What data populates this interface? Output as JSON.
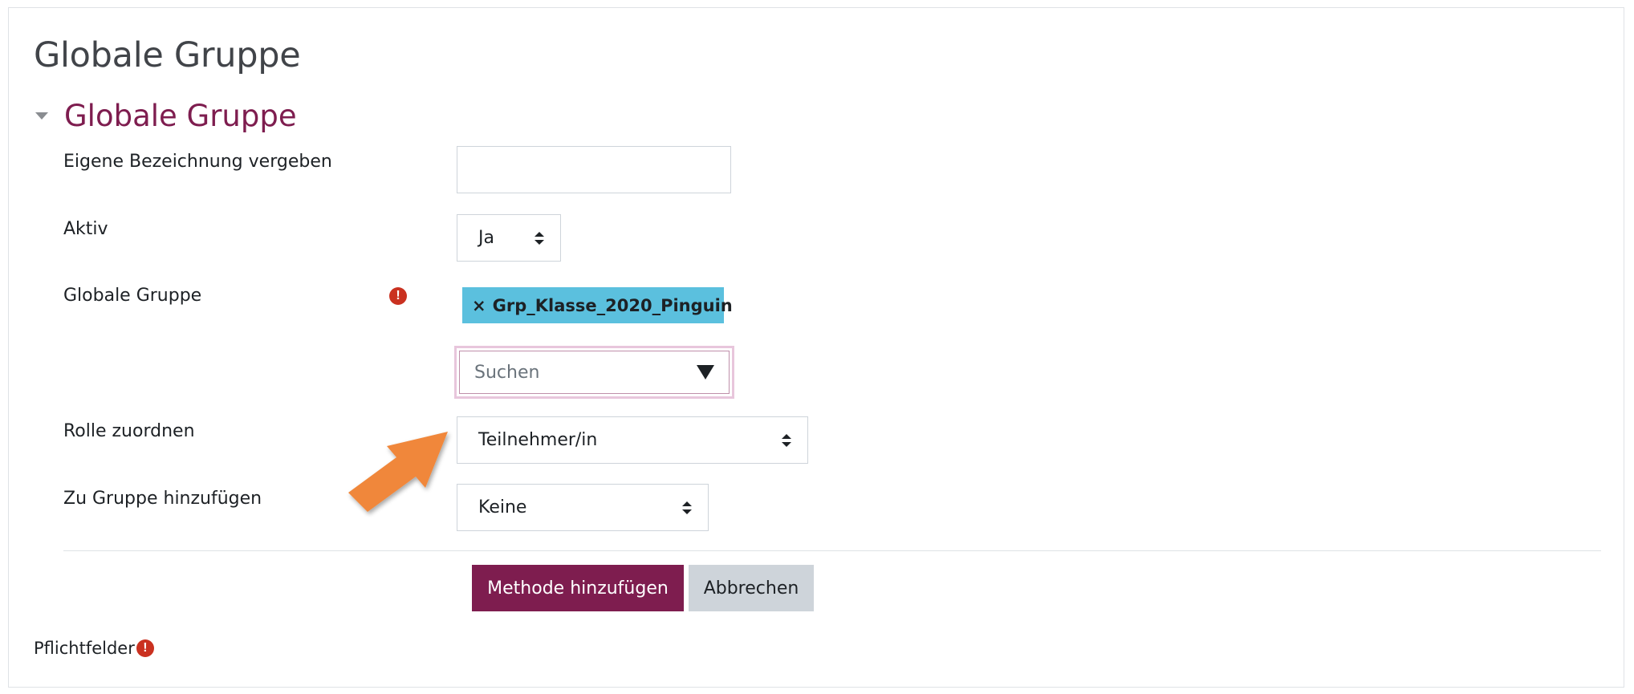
{
  "page": {
    "title": "Globale Gruppe"
  },
  "section": {
    "title": "Globale Gruppe"
  },
  "form": {
    "name_label": "Eigene Bezeichnung vergeben",
    "name_value": "",
    "active_label": "Aktiv",
    "active_value": "Ja",
    "group_label": "Globale Gruppe",
    "group_required_icon": "!",
    "selected_group_remove": "×",
    "selected_group": "Grp_Klasse_2020_Pinguin",
    "search_placeholder": "Suchen",
    "role_label": "Rolle zuordnen",
    "role_value": "Teilnehmer/in",
    "add_to_group_label": "Zu Gruppe hinzufügen",
    "add_to_group_value": "Keine"
  },
  "buttons": {
    "submit": "Methode hinzufügen",
    "cancel": "Abbrechen"
  },
  "footer": {
    "required_note": "Pflichtfelder",
    "required_icon": "!"
  },
  "colors": {
    "accent": "#7e1d4f",
    "tag": "#5bc0de",
    "required": "#ca3120",
    "annotation_arrow": "#f0873a"
  },
  "icons": {
    "section_toggle": "caret-down-icon",
    "required": "exclamation-circle-icon",
    "select": "sort-updown-icon",
    "search_dropdown": "triangle-down-icon",
    "annotation": "orange-arrow-icon"
  }
}
